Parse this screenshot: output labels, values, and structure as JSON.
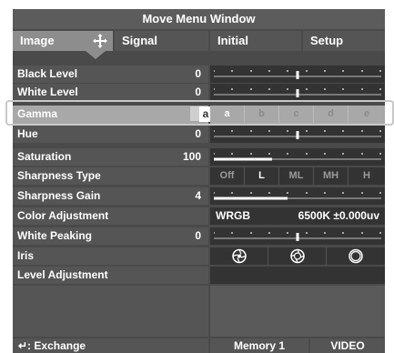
{
  "window": {
    "title": "Move Menu Window"
  },
  "tabs": [
    {
      "label": "Image"
    },
    {
      "label": "Signal"
    },
    {
      "label": "Initial"
    },
    {
      "label": "Setup"
    }
  ],
  "left_rows": [
    {
      "label": "Black Level",
      "value": "0"
    },
    {
      "label": "White Level",
      "value": "0"
    },
    {
      "label": "Gamma",
      "value": "a"
    },
    {
      "label": "Hue",
      "value": "0"
    },
    {
      "label": "Saturation",
      "value": "100"
    },
    {
      "label": "Sharpness Type",
      "value": ""
    },
    {
      "label": "Sharpness Gain",
      "value": "4"
    },
    {
      "label": "Color Adjustment",
      "value": ""
    },
    {
      "label": "White Peaking",
      "value": "0"
    },
    {
      "label": "Iris",
      "value": ""
    },
    {
      "label": "Level Adjustment",
      "value": ""
    }
  ],
  "sliders": {
    "black_level": 0.5,
    "white_level": 0.5,
    "hue": 0.5,
    "saturation": 0.35,
    "sharpness_gain": 0.44,
    "white_peaking": 0.5
  },
  "gamma_options": [
    "a",
    "b",
    "c",
    "d",
    "e"
  ],
  "sharpness_options": [
    "Off",
    "L",
    "ML",
    "MH",
    "H"
  ],
  "sharpness_selected": "L",
  "color_adjustment": {
    "label": "WRGB",
    "value": "6500K ±0.000uv"
  },
  "iris_icons": [
    "aperture-small-icon",
    "aperture-medium-icon",
    "aperture-large-icon"
  ],
  "bottom": {
    "exchange": "↵: Exchange",
    "memory": "Memory 1",
    "video": "VIDEO"
  },
  "colors": {
    "panel": "#555555",
    "selected": "#a8a8a8",
    "title": "#5c5c5c"
  }
}
